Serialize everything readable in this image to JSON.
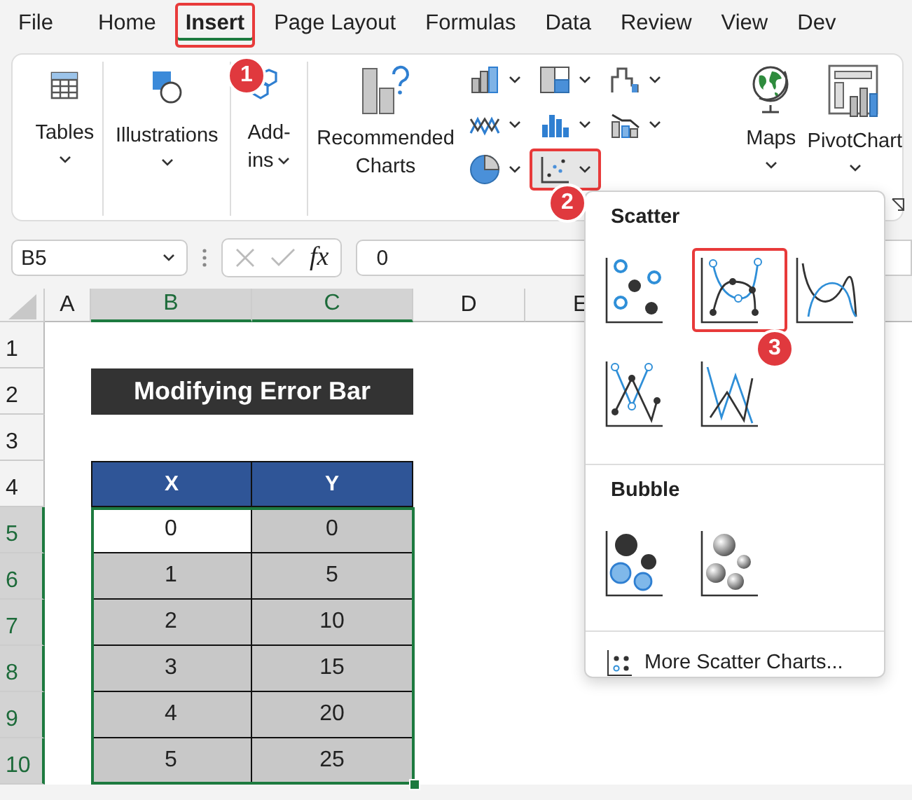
{
  "menu_tabs": [
    {
      "label": "File",
      "selected": false,
      "marked": false
    },
    {
      "label": "Home",
      "selected": false,
      "marked": false
    },
    {
      "label": "Insert",
      "selected": true,
      "marked": true
    },
    {
      "label": "Page Layout",
      "selected": false,
      "marked": false
    },
    {
      "label": "Formulas",
      "selected": false,
      "marked": false
    },
    {
      "label": "Data",
      "selected": false,
      "marked": false
    },
    {
      "label": "Review",
      "selected": false,
      "marked": false
    },
    {
      "label": "View",
      "selected": false,
      "marked": false
    },
    {
      "label": "Dev",
      "selected": false,
      "marked": false
    }
  ],
  "ribbon": {
    "left": [
      {
        "kind": "tables",
        "label": [
          "Tables"
        ],
        "dropdown": true
      },
      {
        "kind": "illustrations",
        "label": [
          "Illustrations"
        ],
        "dropdown": true
      },
      {
        "kind": "addins",
        "label": [
          "Add-",
          "ins"
        ],
        "dropdown": true
      },
      {
        "kind": "recommended",
        "label": [
          "Recommended",
          "Charts"
        ],
        "dropdown": false
      }
    ],
    "chart_buttons": [
      {
        "kind": "column",
        "selected": false,
        "marked": false
      },
      {
        "kind": "hierarchy",
        "selected": false,
        "marked": false
      },
      {
        "kind": "waterfall",
        "selected": false,
        "marked": false
      },
      {
        "kind": "line",
        "selected": false,
        "marked": false
      },
      {
        "kind": "statistic",
        "selected": false,
        "marked": false
      },
      {
        "kind": "combo",
        "selected": false,
        "marked": false
      },
      {
        "kind": "pie",
        "selected": false,
        "marked": false
      },
      {
        "kind": "scatter",
        "selected": true,
        "marked": true
      }
    ],
    "right": [
      {
        "kind": "maps",
        "label": [
          "Maps"
        ],
        "dropdown": true
      },
      {
        "kind": "pivotchart",
        "label": [
          "PivotChart"
        ],
        "dropdown": true
      }
    ]
  },
  "formula_bar": {
    "name_box": "B5",
    "function_label": "fx",
    "value": "0"
  },
  "sheet": {
    "columns": [
      {
        "label": "A",
        "selected": false
      },
      {
        "label": "B",
        "selected": true
      },
      {
        "label": "C",
        "selected": true
      },
      {
        "label": "D",
        "selected": false
      },
      {
        "label": "E",
        "selected": false
      }
    ],
    "rows": [
      {
        "label": "1",
        "selected": false
      },
      {
        "label": "2",
        "selected": false
      },
      {
        "label": "3",
        "selected": false
      },
      {
        "label": "4",
        "selected": false
      },
      {
        "label": "5",
        "selected": true
      },
      {
        "label": "6",
        "selected": true
      },
      {
        "label": "7",
        "selected": true
      },
      {
        "label": "8",
        "selected": true
      },
      {
        "label": "9",
        "selected": true
      },
      {
        "label": "10",
        "selected": true
      }
    ],
    "title": "Modifying Error Bar",
    "table_headers": [
      "X",
      "Y"
    ],
    "table_rows": [
      [
        {
          "text": "0",
          "active": true
        },
        {
          "text": "0",
          "active": false
        }
      ],
      [
        {
          "text": "1",
          "active": false
        },
        {
          "text": "5",
          "active": false
        }
      ],
      [
        {
          "text": "2",
          "active": false
        },
        {
          "text": "10",
          "active": false
        }
      ],
      [
        {
          "text": "3",
          "active": false
        },
        {
          "text": "15",
          "active": false
        }
      ],
      [
        {
          "text": "4",
          "active": false
        },
        {
          "text": "20",
          "active": false
        }
      ],
      [
        {
          "text": "5",
          "active": false
        },
        {
          "text": "25",
          "active": false
        }
      ]
    ]
  },
  "dropdown": {
    "sections": [
      {
        "title": "Scatter",
        "items": [
          {
            "kind": "markers",
            "marked": false
          },
          {
            "kind": "smooth-markers",
            "marked": true
          },
          {
            "kind": "smooth",
            "marked": false
          },
          {
            "kind": "straight-markers",
            "marked": false
          },
          {
            "kind": "straight",
            "marked": false
          }
        ]
      },
      {
        "title": "Bubble",
        "items": [
          {
            "kind": "bubble",
            "marked": false
          },
          {
            "kind": "bubble-3d",
            "marked": false
          }
        ]
      }
    ],
    "more_link": "More Scatter Charts..."
  },
  "callouts": [
    "1",
    "2",
    "3"
  ]
}
